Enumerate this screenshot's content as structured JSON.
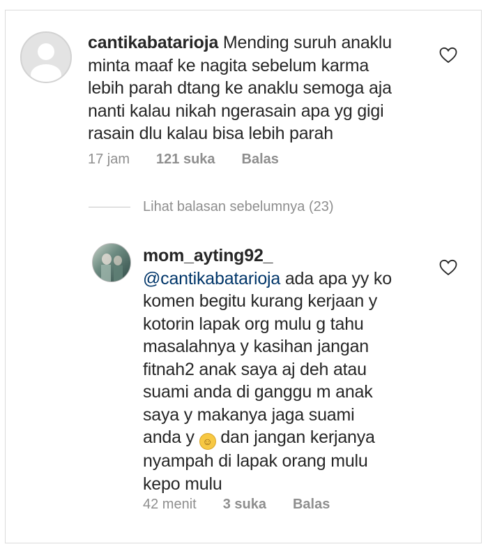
{
  "comment1": {
    "username": "cantikabatarioja",
    "text_line1": " Mending suruh anaklu",
    "text_rest": [
      "minta maaf ke nagita sebelum karma",
      "lebih parah dtang ke anaklu semoga aja",
      "nanti kalau nikah ngerasain apa yg gigi",
      "rasain dlu kalau bisa lebih parah"
    ],
    "time": "17 jam",
    "likes": "121 suka",
    "reply_label": "Balas",
    "avatar_icon": "default-avatar-icon",
    "like_icon": "heart-outline-icon"
  },
  "view_replies": {
    "label": "Lihat balasan sebelumnya (23)"
  },
  "comment2": {
    "username": "mom_ayting92_",
    "mention": "@cantikabatarioja",
    "line1_rest": " ada apa yy ko",
    "lines": [
      "komen begitu kurang kerjaan y",
      "kotorin lapak org mulu g tahu",
      "masalahnya y kasihan jangan",
      "fitnah2 anak saya aj deh atau",
      "suami anda di ganggu m anak",
      "saya y makanya jaga suami"
    ],
    "line_before_emoji": "anda y ",
    "emoji": "☺",
    "line_after_emoji": " dan jangan kerjanya",
    "lines_end": [
      "nyampah di lapak orang mulu",
      "kepo mulu"
    ],
    "time": "42 menit",
    "likes": "3 suka",
    "reply_label": "Balas",
    "avatar_icon": "profile-photo-avatar",
    "like_icon": "heart-outline-icon"
  }
}
